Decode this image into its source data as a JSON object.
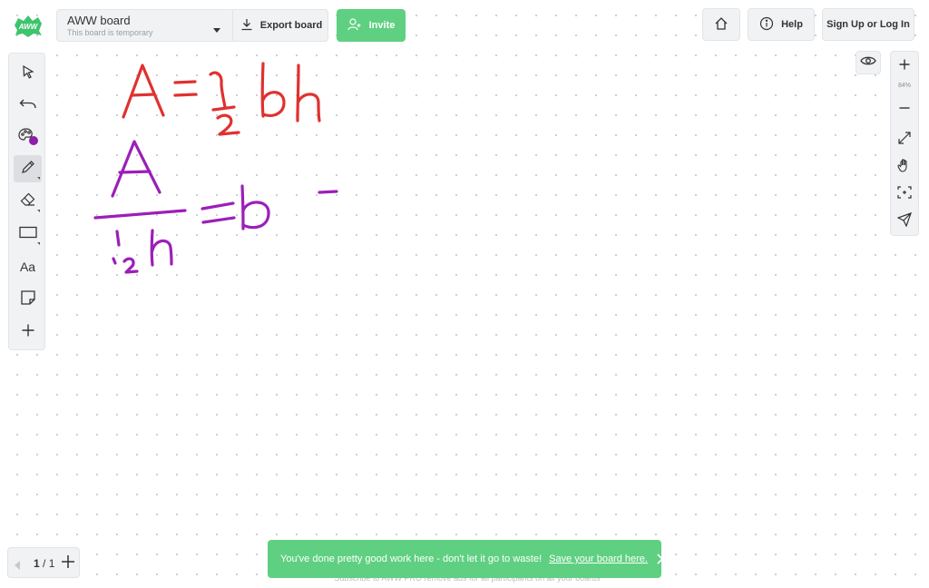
{
  "app": {
    "logo_text": "AWW"
  },
  "board": {
    "name": "AWW board",
    "subtitle": "This board is temporary"
  },
  "toolbar": {
    "export_label": "Export board",
    "invite_label": "Invite",
    "help_label": "Help",
    "signup_label": "Sign Up or Log In"
  },
  "left_tools": [
    {
      "name": "select",
      "icon": "cursor-icon"
    },
    {
      "name": "undo",
      "icon": "undo-icon"
    },
    {
      "name": "color",
      "icon": "palette-icon",
      "color": "#8b1fa8"
    },
    {
      "name": "pencil",
      "icon": "pencil-icon",
      "active": true
    },
    {
      "name": "eraser",
      "icon": "eraser-icon"
    },
    {
      "name": "shapes",
      "icon": "rectangle-icon"
    },
    {
      "name": "text",
      "label": "Aa"
    },
    {
      "name": "sticky-note",
      "icon": "sticky-note-icon"
    },
    {
      "name": "more",
      "icon": "plus-icon"
    }
  ],
  "zoom": {
    "level": "84%"
  },
  "pager": {
    "current": "1",
    "separator": "/",
    "total": "1"
  },
  "toast": {
    "message": "You've done pretty good work here - don't let it go to waste!",
    "link": "Save your board here."
  },
  "footer": {
    "text": "Subscribe to AWW PRO remove ads for all participants on all your boards"
  },
  "drawing": {
    "red_color": "#e0312f",
    "purple_color": "#9b1fb8",
    "equation_1": "A = ½ bh",
    "equation_2": "A / ½h = b"
  },
  "colors": {
    "accent": "#5fd081",
    "panel": "#f1f2f4"
  }
}
